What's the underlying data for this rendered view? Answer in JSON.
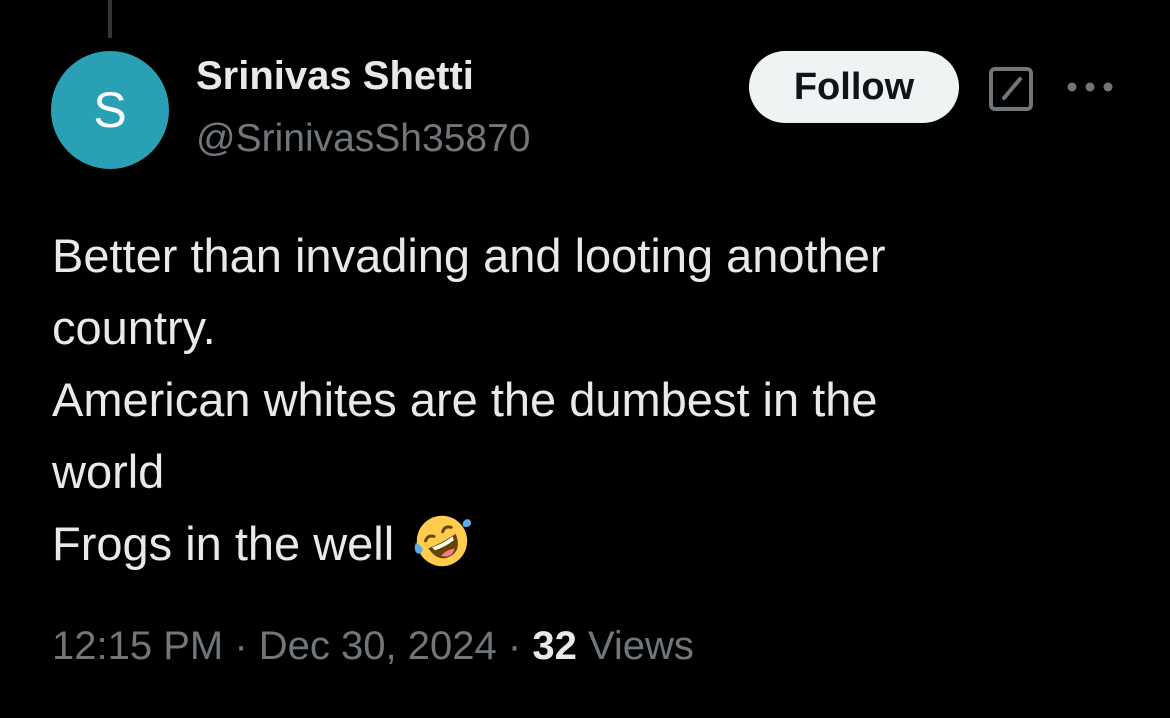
{
  "author": {
    "avatar_letter": "S",
    "avatar_color": "#2aa0b5",
    "name": "Srinivas Shetti",
    "handle": "@SrinivasSh35870"
  },
  "actions": {
    "follow_label": "Follow",
    "grok_icon": "grok-icon",
    "more_icon": "more-icon"
  },
  "tweet": {
    "lines": [
      "Better than invading and looting another",
      "country.",
      "American whites are the dumbest in the",
      "world",
      "Frogs in the well"
    ],
    "emoji": "rolling-on-floor-laughing-emoji"
  },
  "meta": {
    "time": "12:15 PM",
    "separator": "·",
    "date": "Dec 30, 2024",
    "views_count": "32",
    "views_label": "Views"
  },
  "colors": {
    "background": "#000000",
    "primary_text": "#e7e9ea",
    "secondary_text": "#71767b",
    "follow_bg": "#eff3f4"
  }
}
